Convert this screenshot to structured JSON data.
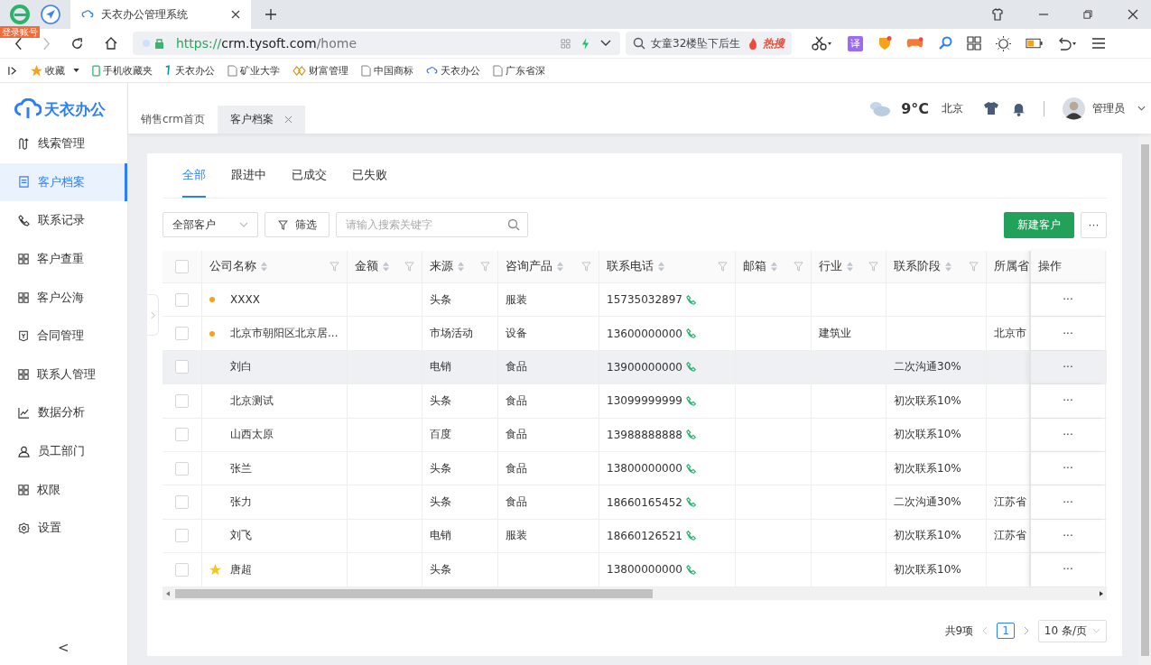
{
  "browser": {
    "login_badge": "登录账号",
    "tabs": [
      {
        "title": "天衣办公管理系统",
        "selected": true
      }
    ],
    "url": {
      "scheme": "https://",
      "host": "crm.tysoft.com",
      "path": "/home"
    },
    "hot_search": {
      "text": "女童32楼坠下后生",
      "badge": "热搜"
    },
    "translate_label": "译",
    "bookmarks": [
      {
        "label": "收藏",
        "kind": "star"
      },
      {
        "label": "手机收藏夹",
        "kind": "phone"
      },
      {
        "label": "天衣办公",
        "kind": "brand"
      },
      {
        "label": "矿业大学",
        "kind": "page"
      },
      {
        "label": "财富管理",
        "kind": "diamond"
      },
      {
        "label": "中国商标",
        "kind": "page"
      },
      {
        "label": "天衣办公",
        "kind": "cloud"
      },
      {
        "label": "广东省深",
        "kind": "page"
      }
    ]
  },
  "app": {
    "logo": "天衣办公",
    "sidebar": {
      "items": [
        {
          "label": "线索管理",
          "kind": "flow",
          "selected": false
        },
        {
          "label": "客户档案",
          "kind": "doc",
          "selected": true
        },
        {
          "label": "联系记录",
          "kind": "phone",
          "selected": false
        },
        {
          "label": "客户查重",
          "kind": "grid",
          "selected": false
        },
        {
          "label": "客户公海",
          "kind": "grid",
          "selected": false
        },
        {
          "label": "合同管理",
          "kind": "contract",
          "selected": false
        },
        {
          "label": "联系人管理",
          "kind": "grid",
          "selected": false
        },
        {
          "label": "数据分析",
          "kind": "chart",
          "selected": false
        },
        {
          "label": "员工部门",
          "kind": "person",
          "selected": false
        },
        {
          "label": "权限",
          "kind": "grid",
          "selected": false
        },
        {
          "label": "设置",
          "kind": "gear",
          "selected": false
        }
      ],
      "collapse": "<"
    },
    "page_tabs": [
      {
        "label": "销售crm首页",
        "selected": false,
        "closable": false
      },
      {
        "label": "客户档案",
        "selected": true,
        "closable": true
      }
    ],
    "header": {
      "temperature": "9°C",
      "city": "北京",
      "user": "管理员"
    },
    "filter_tabs": [
      {
        "label": "全部",
        "selected": true
      },
      {
        "label": "跟进中",
        "selected": false
      },
      {
        "label": "已成交",
        "selected": false
      },
      {
        "label": "已失败",
        "selected": false
      }
    ],
    "toolbar": {
      "scope": "全部客户",
      "filter": "筛选",
      "search": {
        "placeholder": "请输入搜索关键字"
      },
      "new": "新建客户",
      "more": "···"
    },
    "table": {
      "columns": [
        {
          "label": "公司名称",
          "sortable": true,
          "filterable": true
        },
        {
          "label": "金额",
          "sortable": true,
          "filterable": true
        },
        {
          "label": "来源",
          "sortable": true,
          "filterable": true
        },
        {
          "label": "咨询产品",
          "sortable": true,
          "filterable": true
        },
        {
          "label": "联系电话",
          "sortable": true,
          "filterable": true
        },
        {
          "label": "邮箱",
          "sortable": true,
          "filterable": true
        },
        {
          "label": "行业",
          "sortable": true,
          "filterable": true
        },
        {
          "label": "联系阶段",
          "sortable": true,
          "filterable": true
        },
        {
          "label": "所属省",
          "sortable": false,
          "filterable": false
        },
        {
          "label": "操作",
          "sortable": false,
          "filterable": false
        }
      ],
      "all_checked": false,
      "rows": [
        {
          "flagged": true,
          "starred": false,
          "checked": false,
          "highlighted": false,
          "cells": [
            "XXXX",
            "",
            "头条",
            "服装",
            "15735032897",
            "",
            "",
            "",
            ""
          ],
          "action": "···"
        },
        {
          "flagged": true,
          "starred": false,
          "checked": false,
          "highlighted": false,
          "cells": [
            "北京市朝阳区北京居...",
            "",
            "市场活动",
            "设备",
            "13600000000",
            "",
            "建筑业",
            "",
            "北京市"
          ],
          "action": "···"
        },
        {
          "flagged": false,
          "starred": false,
          "checked": false,
          "highlighted": true,
          "cells": [
            "刘白",
            "",
            "电销",
            "食品",
            "13900000000",
            "",
            "",
            "二次沟通30%",
            ""
          ],
          "action": "···"
        },
        {
          "flagged": false,
          "starred": false,
          "checked": false,
          "highlighted": false,
          "cells": [
            "北京测试",
            "",
            "头条",
            "食品",
            "13099999999",
            "",
            "",
            "初次联系10%",
            ""
          ],
          "action": "···"
        },
        {
          "flagged": false,
          "starred": false,
          "checked": false,
          "highlighted": false,
          "cells": [
            "山西太原",
            "",
            "百度",
            "食品",
            "13988888888",
            "",
            "",
            "初次联系10%",
            ""
          ],
          "action": "···"
        },
        {
          "flagged": false,
          "starred": false,
          "checked": false,
          "highlighted": false,
          "cells": [
            "张兰",
            "",
            "头条",
            "食品",
            "13800000000",
            "",
            "",
            "初次联系10%",
            ""
          ],
          "action": "···"
        },
        {
          "flagged": false,
          "starred": false,
          "checked": false,
          "highlighted": false,
          "cells": [
            "张力",
            "",
            "头条",
            "食品",
            "18660165452",
            "",
            "",
            "二次沟通30%",
            "江苏省"
          ],
          "action": "···"
        },
        {
          "flagged": false,
          "starred": false,
          "checked": false,
          "highlighted": false,
          "cells": [
            "刘飞",
            "",
            "电销",
            "服装",
            "18660126521",
            "",
            "",
            "初次联系10%",
            "江苏省"
          ],
          "action": "···"
        },
        {
          "flagged": false,
          "starred": true,
          "checked": false,
          "highlighted": false,
          "cells": [
            "唐超",
            "",
            "头条",
            "",
            "13800000000",
            "",
            "",
            "初次联系10%",
            ""
          ],
          "action": "···"
        }
      ]
    },
    "pagination": {
      "total": "共9项",
      "page": "1",
      "page_size": "10 条/页"
    }
  }
}
